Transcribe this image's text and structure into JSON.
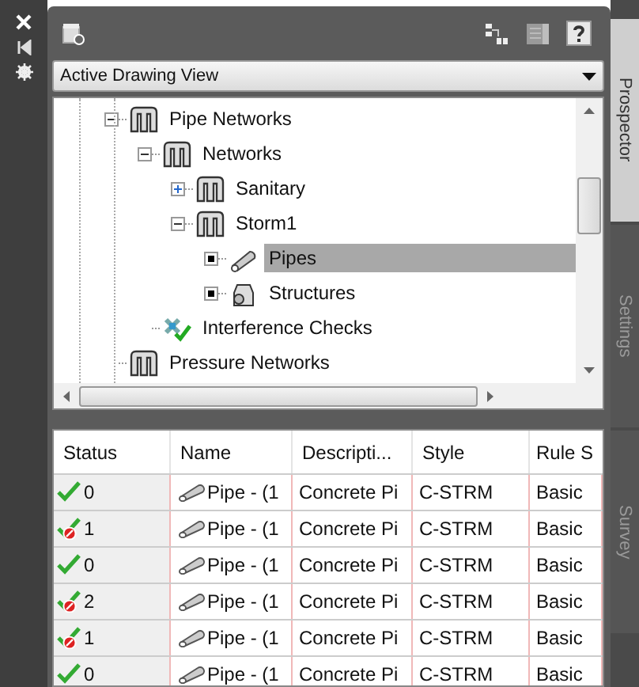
{
  "view_dropdown": {
    "value": "Active Drawing View"
  },
  "tree": [
    {
      "label": "Pipe Networks",
      "kind": "network",
      "expanded": true,
      "selected": false,
      "children": [
        {
          "label": "Networks",
          "kind": "network",
          "expanded": true,
          "selected": false,
          "children": [
            {
              "label": "Sanitary",
              "kind": "network",
              "expanded": false,
              "selected": false
            },
            {
              "label": "Storm1",
              "kind": "network",
              "expanded": true,
              "selected": false,
              "children": [
                {
                  "label": "Pipes",
                  "kind": "pipe",
                  "expanded": false,
                  "selected": true
                },
                {
                  "label": "Structures",
                  "kind": "structure",
                  "expanded": false,
                  "selected": false
                }
              ]
            }
          ]
        },
        {
          "label": "Interference Checks",
          "kind": "check",
          "selected": false
        }
      ]
    },
    {
      "label": "Pressure Networks",
      "kind": "network",
      "selected": false
    }
  ],
  "table": {
    "columns": [
      "Status",
      "Name",
      "Descripti...",
      "Style",
      "Rule S"
    ],
    "rows": [
      {
        "status": "0",
        "warning": false,
        "name": "Pipe - (1",
        "description": "Concrete Pi",
        "style": "C-STRM",
        "rule": "Basic"
      },
      {
        "status": "1",
        "warning": true,
        "name": "Pipe - (1",
        "description": "Concrete Pi",
        "style": "C-STRM",
        "rule": "Basic"
      },
      {
        "status": "0",
        "warning": false,
        "name": "Pipe - (1",
        "description": "Concrete Pi",
        "style": "C-STRM",
        "rule": "Basic"
      },
      {
        "status": "2",
        "warning": true,
        "name": "Pipe - (1",
        "description": "Concrete Pi",
        "style": "C-STRM",
        "rule": "Basic"
      },
      {
        "status": "1",
        "warning": true,
        "name": "Pipe - (1",
        "description": "Concrete Pi",
        "style": "C-STRM",
        "rule": "Basic"
      },
      {
        "status": "0",
        "warning": false,
        "name": "Pipe - (1",
        "description": "Concrete Pi",
        "style": "C-STRM",
        "rule": "Basic"
      }
    ]
  },
  "side_tabs": [
    {
      "label": "Prospector",
      "selected": true
    },
    {
      "label": "Settings",
      "selected": false
    },
    {
      "label": "Survey",
      "selected": false
    }
  ]
}
